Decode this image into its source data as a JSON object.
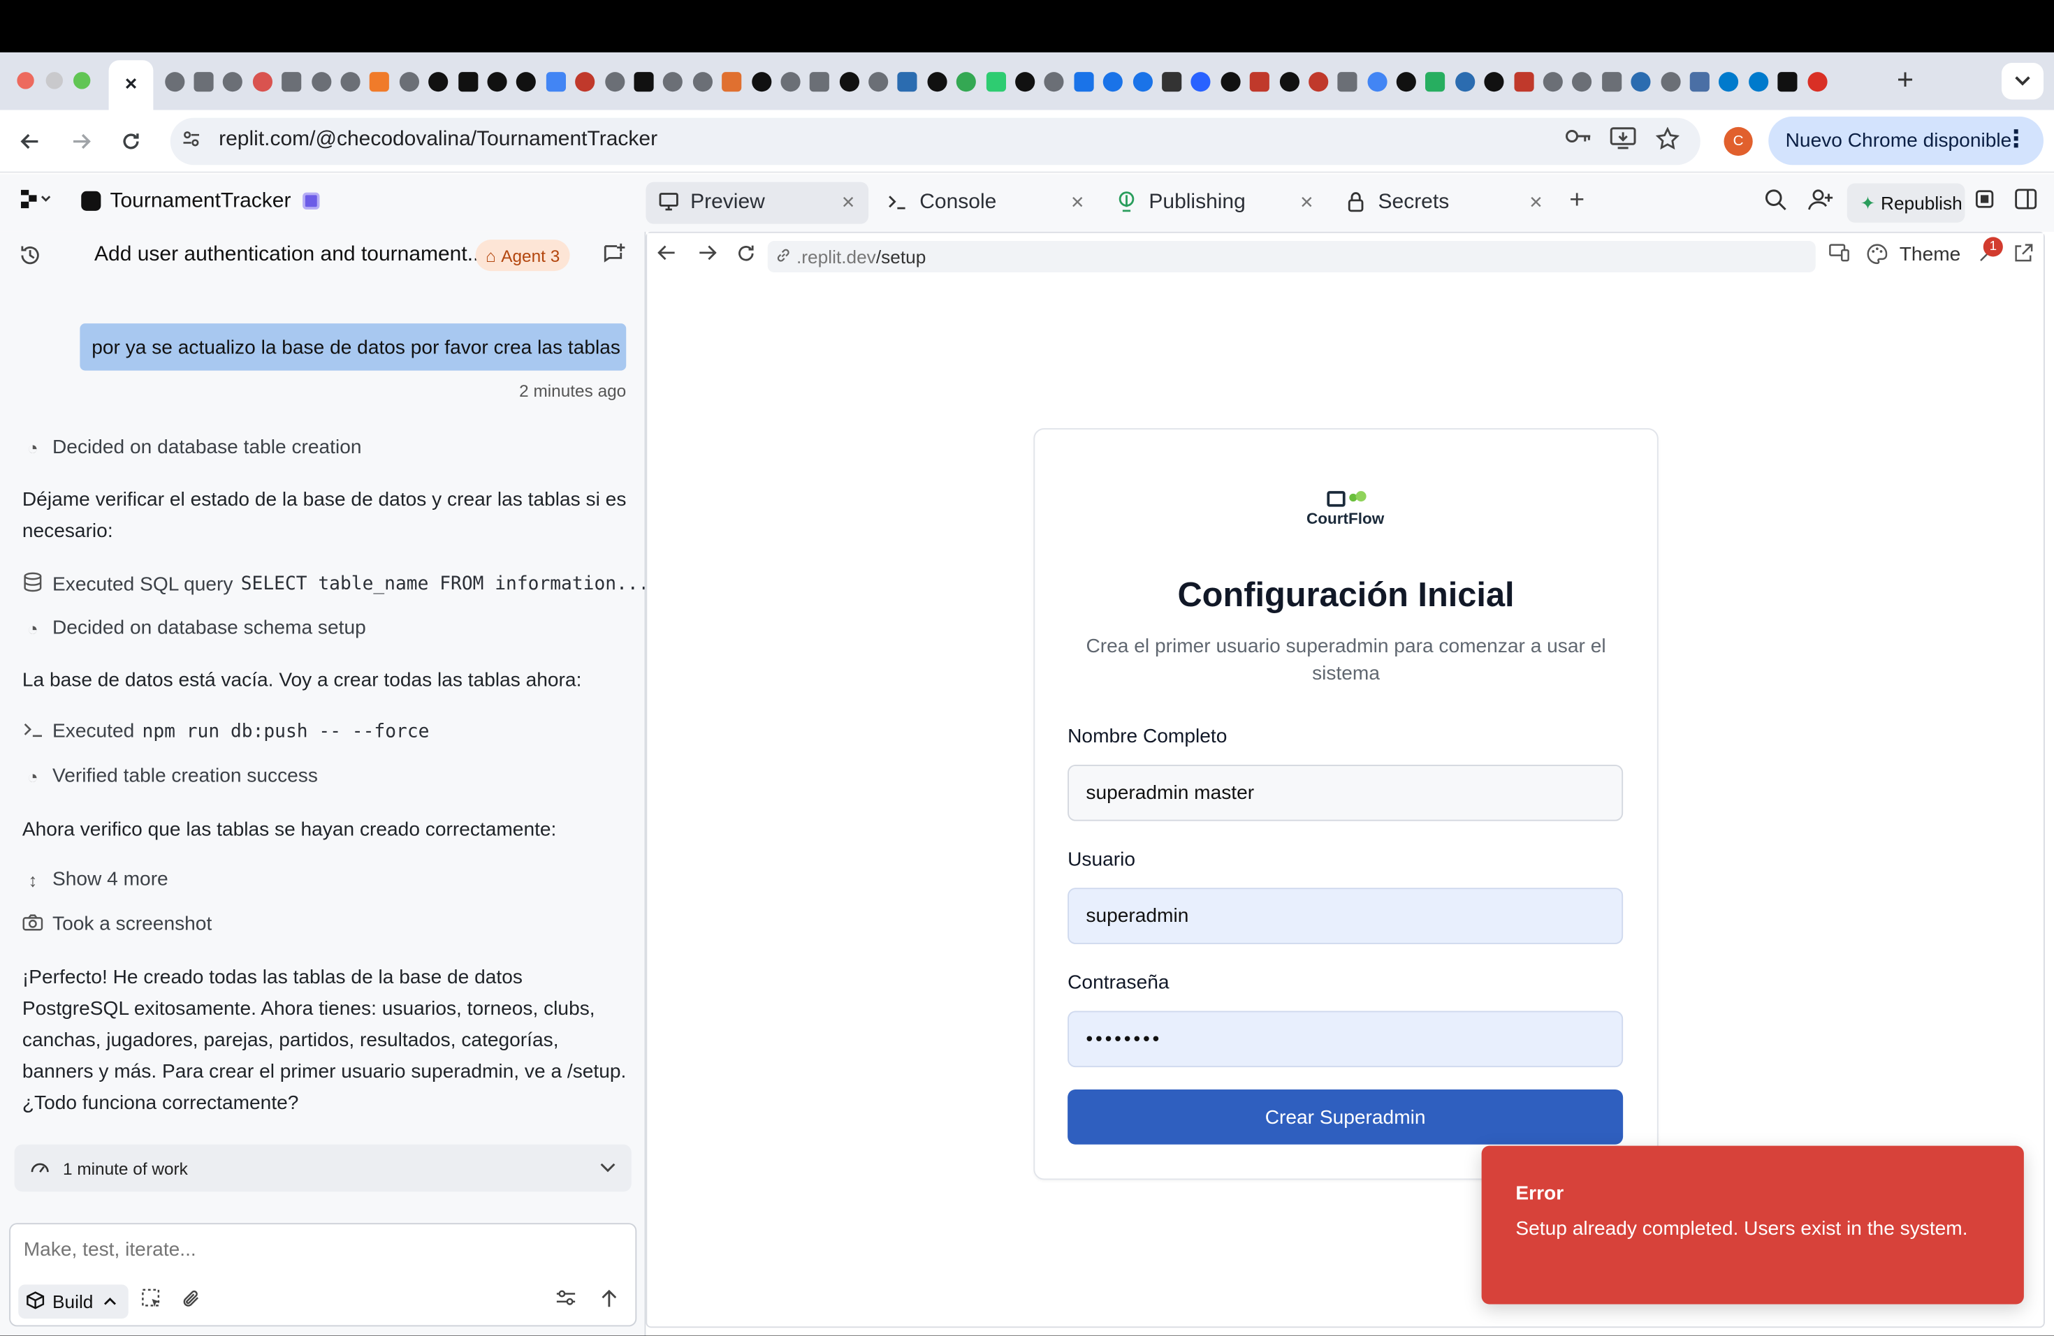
{
  "browser": {
    "active_tab_close": "×",
    "new_tab": "+",
    "url": "replit.com/@checodovalina/TournamentTracker",
    "profile_initial": "C",
    "update_button": "Nuevo Chrome disponible",
    "update_menu": "⋮"
  },
  "replit": {
    "app_name": "TournamentTracker",
    "tabs": [
      {
        "label": "Preview",
        "icon": "monitor-icon"
      },
      {
        "label": "Console",
        "icon": "terminal-icon"
      },
      {
        "label": "Publishing",
        "icon": "publish-icon"
      },
      {
        "label": "Secrets",
        "icon": "lock-icon"
      }
    ],
    "republish_label": "Republish"
  },
  "chat": {
    "title": "Add user authentication and tournament...",
    "agent_badge": "Agent 3",
    "user_message": "por ya se actualizo la base de datos por favor crea las tablas",
    "user_message_time": "2 minutes ago",
    "step1": "Decided on database table creation",
    "para1": "Déjame verificar el estado de la base de datos y crear las tablas si es necesario:",
    "step2_label": "Executed SQL query",
    "step2_code": "SELECT table_name FROM information...",
    "step3": "Decided on database schema setup",
    "para2": "La base de datos está vacía. Voy a crear todas las tablas ahora:",
    "step4_label": "Executed",
    "step4_code": "npm run db:push -- --force",
    "step5": "Verified table creation success",
    "para3": "Ahora verifico que las tablas se hayan creado correctamente:",
    "show_more": "Show 4 more",
    "step6": "Took a screenshot",
    "para4": "¡Perfecto! He creado todas las tablas de la base de datos PostgreSQL exitosamente. Ahora tienes: usuarios, torneos, clubs, canchas, jugadores, parejas, partidos, resultados, categorías, banners y más. Para crear el primer usuario superadmin, ve a /setup. ¿Todo funciona correctamente?",
    "work_summary": "1 minute of work",
    "input_placeholder": "Make, test, iterate...",
    "build_label": "Build"
  },
  "preview": {
    "url_host": ".replit.dev",
    "url_path": "/setup",
    "theme_label": "Theme",
    "notification_count": "1",
    "brand_name": "CourtFlow",
    "title": "Configuración Inicial",
    "subtitle": "Crea el primer usuario superadmin para comenzar a usar el sistema",
    "fields": [
      {
        "label": "Nombre Completo",
        "value": "superadmin master"
      },
      {
        "label": "Usuario",
        "value": "superadmin"
      },
      {
        "label": "Contraseña",
        "value": "••••••••"
      }
    ],
    "submit_label": "Crear Superadmin"
  },
  "toast": {
    "title": "Error",
    "message": "Setup already completed. Users exist in the system."
  },
  "colors": {
    "primary_button": "#2f5fbf",
    "toast_error": "#d7423a",
    "user_bubble": "#a8c8f0",
    "agent_badge": "#fde5d6"
  }
}
